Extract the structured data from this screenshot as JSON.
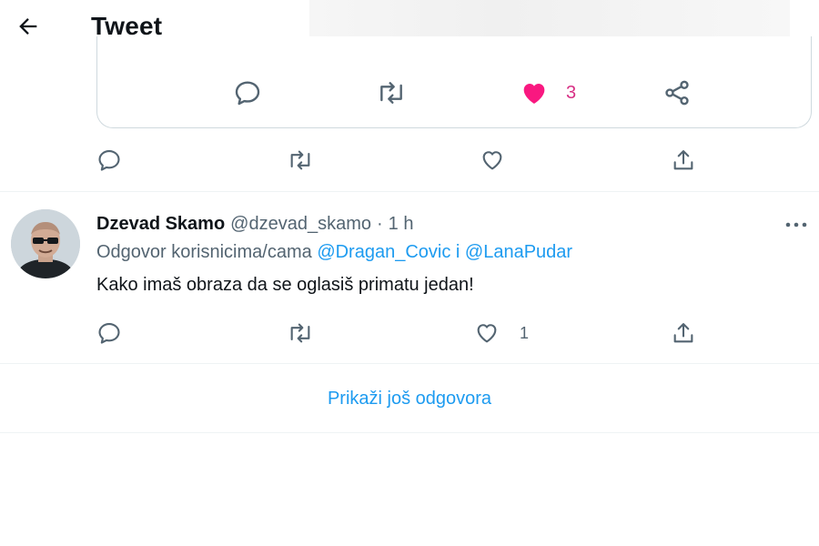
{
  "header": {
    "title": "Tweet"
  },
  "quoted": {
    "like_count": "3"
  },
  "reply": {
    "display_name": "Dzevad Skamo",
    "handle": "@dzevad_skamo",
    "separator": "·",
    "time": "1 h",
    "replying_prefix": "Odgovor korisnicima/cama",
    "mention_1": "@Dragan_Covic",
    "joiner": "i",
    "mention_2": "@LanaPudar",
    "text": "Kako imaš obraza da se oglasiš primatu jedan!",
    "like_count": "1"
  },
  "show_more": "Prikaži još odgovora",
  "colors": {
    "accent": "#1d9bf0",
    "like": "#f91880",
    "secondary_text": "#536471",
    "divider": "#eff3f4"
  },
  "icons": [
    "back-arrow-icon",
    "reply-icon",
    "retweet-icon",
    "like-icon",
    "share-icon",
    "more-icon"
  ]
}
